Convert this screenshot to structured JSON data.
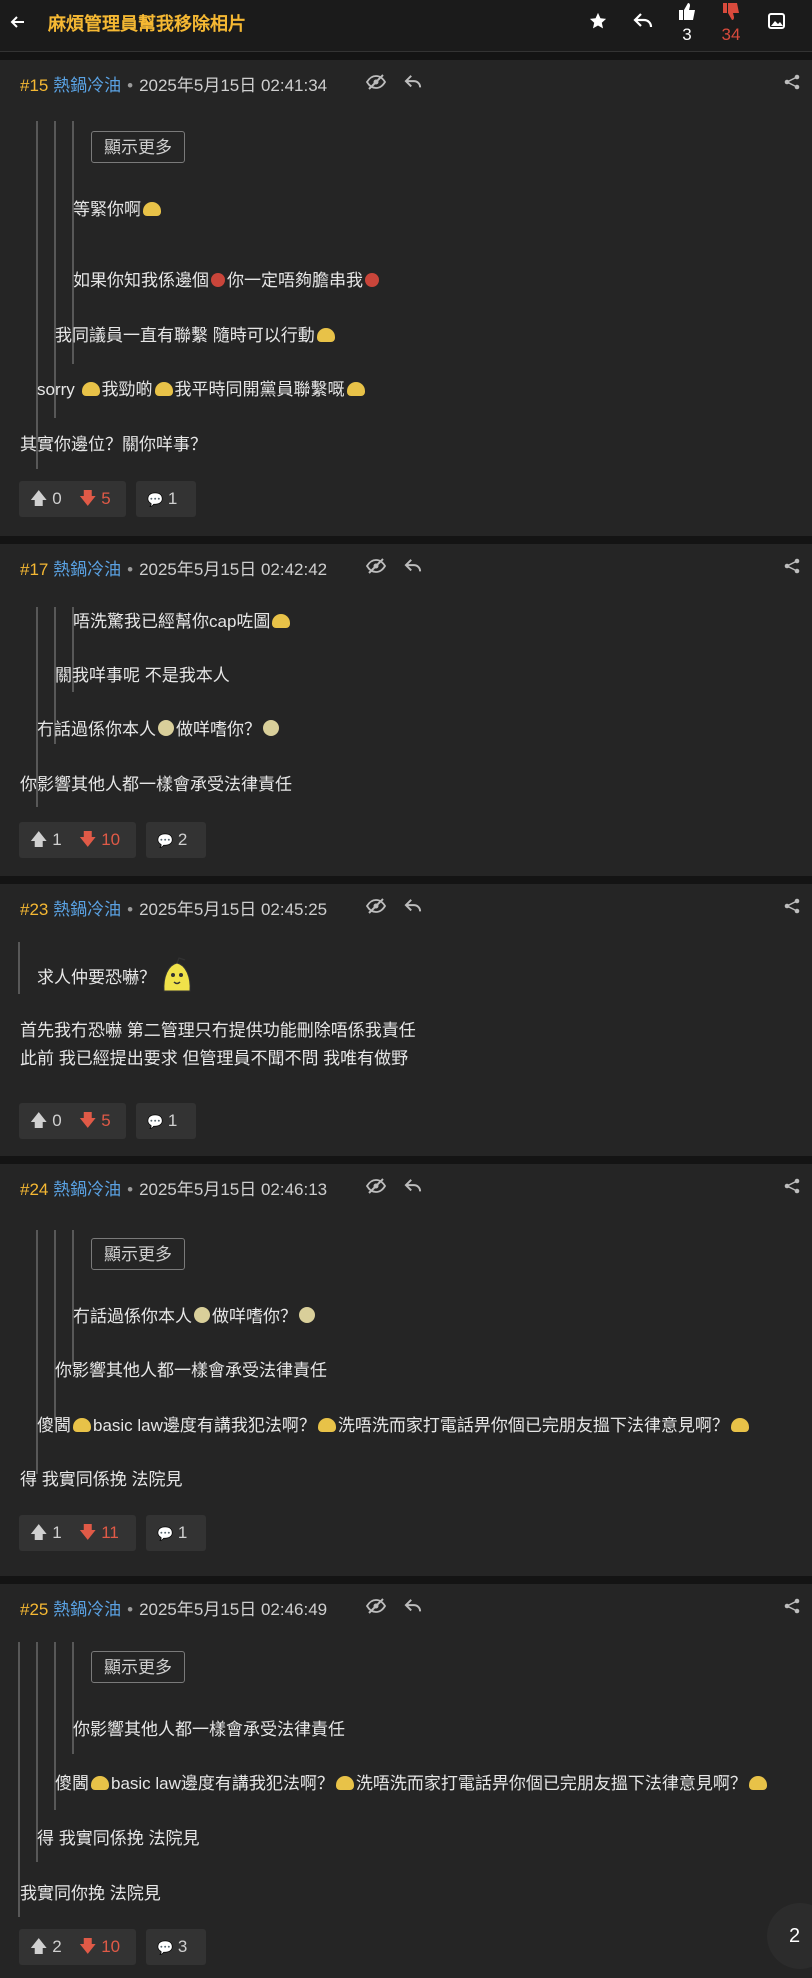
{
  "header": {
    "title": "麻煩管理員幫我移除相片",
    "like_count": "3",
    "dislike_count": "34"
  },
  "posts": [
    {
      "num": "#15",
      "user": "熱鍋冷油",
      "sep": "•",
      "date": "2025年5月15日 02:41:34",
      "quotes": {
        "more": "顯示更多",
        "l3a": "等緊你啊",
        "l3b": "如果你知我係邊個",
        "l3b2": "你一定唔夠膽串我",
        "l2": "我同議員一直有聯繫 隨時可以行動",
        "l1a": "sorry ",
        "l1b": "我勁啲",
        "l1c": "我平時同開黨員聯繫嘅"
      },
      "body": [
        "其實你邊位？關你咩事？"
      ],
      "up": "0",
      "down": "5",
      "comments": "1"
    },
    {
      "num": "#17",
      "user": "熱鍋冷油",
      "sep": "•",
      "date": "2025年5月15日 02:42:42",
      "quotes": {
        "l3": "唔洗驚我已經幫你cap咗圖",
        "l2": "關我咩事呢 不是我本人",
        "l1a": "冇話過係你本人",
        "l1b": "做咩嗜你？"
      },
      "body": [
        "你影響其他人都一樣會承受法律責任"
      ],
      "up": "1",
      "down": "10",
      "comments": "2"
    },
    {
      "num": "#23",
      "user": "熱鍋冷油",
      "sep": "•",
      "date": "2025年5月15日 02:45:25",
      "quotes": {
        "l1": "求人仲要恐嚇？"
      },
      "body": [
        "首先我冇恐嚇 第二管理只冇提供功能刪除唔係我責任",
        "此前 我已經提出要求 但管理員不聞不問 我唯有做野"
      ],
      "up": "0",
      "down": "5",
      "comments": "1"
    },
    {
      "num": "#24",
      "user": "熱鍋冷油",
      "sep": "•",
      "date": "2025年5月15日 02:46:13",
      "quotes": {
        "more": "顯示更多",
        "l3a": "冇話過係你本人",
        "l3b": "做咩嗜你？",
        "l2": "你影響其他人都一樣會承受法律責任",
        "l1a": "傻閪",
        "l1b": "basic law邊度有講我犯法啊？",
        "l1c": "洗唔洗而家打電話畀你個已完朋友搵下法律意見啊？"
      },
      "body": [
        "得 我實同係挽 法院見"
      ],
      "up": "1",
      "down": "11",
      "comments": "1"
    },
    {
      "num": "#25",
      "user": "熱鍋冷油",
      "sep": "•",
      "date": "2025年5月15日 02:46:49",
      "quotes": {
        "more": "顯示更多",
        "l3": "你影響其他人都一樣會承受法律責任",
        "l2a": "傻閪",
        "l2b": "basic law邊度有講我犯法啊？",
        "l2c": "洗唔洗而家打電話畀你個已完朋友搵下法律意見啊？",
        "l1": "得 我實同係挽 法院見"
      },
      "body": [
        "我實同你挽 法院見"
      ],
      "up": "2",
      "down": "10",
      "comments": "3"
    }
  ],
  "page_number": "2",
  "colors": {
    "accent": "#f5b833",
    "username": "#5aa2e3",
    "downvote": "#e05a47",
    "background": "#1f1f1f",
    "post_background": "#252525"
  },
  "icons": [
    "back-arrow-icon",
    "star-icon",
    "reply-icon",
    "thumbs-up-icon",
    "thumbs-down-icon",
    "image-icon",
    "hide-icon",
    "share-icon",
    "arrow-up-icon",
    "arrow-down-icon",
    "comment-icon",
    "emoji-icon",
    "sticker-icon"
  ]
}
